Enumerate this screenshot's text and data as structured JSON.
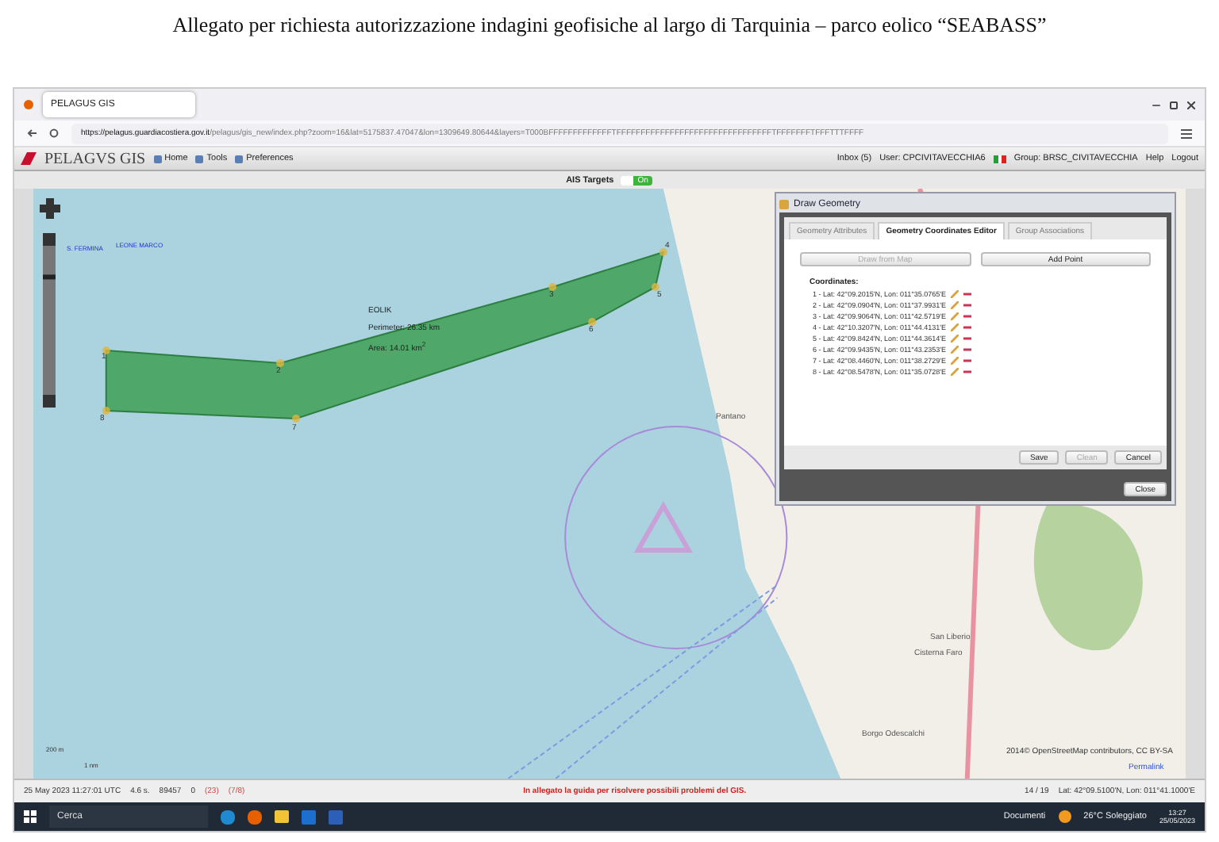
{
  "document": {
    "caption": "Allegato per richiesta autorizzazione indagini geofisiche al largo di Tarquinia – parco eolico “SEABASS”"
  },
  "browser": {
    "tabs": [
      {
        "title": "PELAGUS GIS",
        "selected": true
      }
    ],
    "url_host": "https://pelagus.guardiacostiera.gov.it",
    "url_path": "/pelagus/gis_new/index.php?zoom=16&lat=5175837.47047&lon=1309649.80644&layers=T000BFFFFFFFFFFFFFTFFFFFFFFFFFFFFFFFFFFFFFFFFFFFFFFTFFFFFFFTFFFTTTFFFF"
  },
  "app_toolbar": {
    "logo": "PELAGVS GIS",
    "items": [
      "Home",
      "Tools",
      "Preferences"
    ],
    "inbox": "Inbox (5)",
    "user": "User: CPCIVITAVECCHIA6",
    "group": "Group: BRSC_CIVITAVECCHIA",
    "help": "Help",
    "logout": "Logout"
  },
  "ais": {
    "label": "AIS Targets",
    "toggle": "On",
    "on": true
  },
  "map": {
    "polygon": {
      "name": "EOLIK",
      "perimeter": "Perimeter: 26.35 km",
      "area": "Area: 14.01 km$^{2}$",
      "vertices": [
        "1",
        "2",
        "3",
        "4",
        "5",
        "6",
        "7",
        "8"
      ]
    },
    "vessels": [
      "S. FERMINA",
      "LEONE MARCO"
    ],
    "places": [
      "Pantano",
      "San Liberio",
      "Cisterna Faro",
      "Borgo Odescalchi"
    ],
    "scale": [
      "200 m",
      "1 nm"
    ],
    "zoom_slider": {
      "level": 0.8
    },
    "attribution": "2014© OpenStreetMap contributors, CC BY-SA",
    "permalink": "Permalink"
  },
  "dialog": {
    "title": "Draw Geometry",
    "tabs": [
      {
        "label": "Geometry Attributes",
        "selected": false
      },
      {
        "label": "Geometry Coordinates Editor",
        "selected": true
      },
      {
        "label": "Group Associations",
        "selected": false
      }
    ],
    "draw_button": {
      "label": "Draw from Map",
      "disabled": true
    },
    "add_button": {
      "label": "Add Point",
      "disabled": false
    },
    "coordinates_label": "Coordinates:",
    "coordinates": [
      "1 - Lat: 42°09.2015'N, Lon: 011°35.0765'E",
      "2 - Lat: 42°09.0904'N, Lon: 011°37.9931'E",
      "3 - Lat: 42°09.9064'N, Lon: 011°42.5719'E",
      "4 - Lat: 42°10.3207'N, Lon: 011°44.4131'E",
      "5 - Lat: 42°09.8424'N, Lon: 011°44.3614'E",
      "6 - Lat: 42°09.9435'N, Lon: 011°43.2353'E",
      "7 - Lat: 42°08.4460'N, Lon: 011°38.2729'E",
      "8 - Lat: 42°08.5478'N, Lon: 011°35.0728'E"
    ],
    "footer_buttons": [
      {
        "label": "Save",
        "disabled": false
      },
      {
        "label": "Clean",
        "disabled": true
      },
      {
        "label": "Cancel",
        "disabled": false
      }
    ],
    "close": "Close"
  },
  "status_bar": {
    "time": "25 May 2023 11:27:01 UTC",
    "refresh": "4.6 s.",
    "vessels": "89457",
    "alerts": "0",
    "messages": "(23)",
    "layers": "(7/8)",
    "notice": "In allegato la guida per risolvere possibili problemi del GIS.",
    "pages": "14 / 19",
    "position": "Lat: 42°09.5100'N, Lon: 011°41.1000'E"
  },
  "taskbar": {
    "search": "Cerca",
    "documents": "Documenti",
    "weather": "26°C  Soleggiato",
    "time": "13:27",
    "date": "25/05/2023"
  }
}
